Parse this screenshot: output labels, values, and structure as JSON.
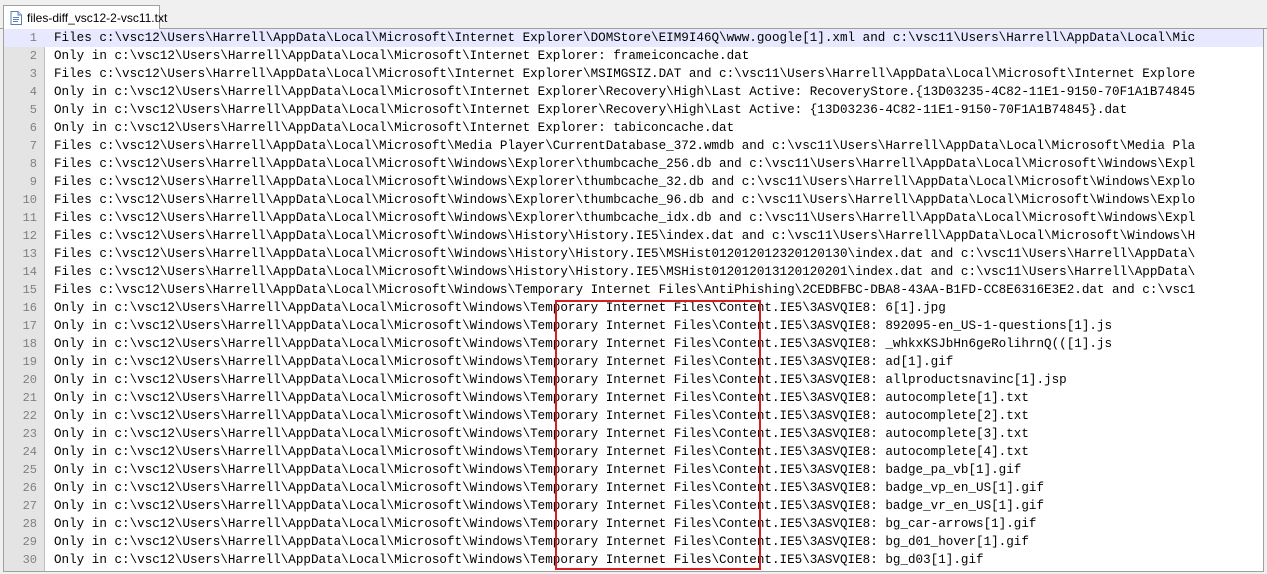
{
  "tab": {
    "title": "files-diff_vsc12-2-vsc11.txt",
    "icon": "file-icon"
  },
  "lines": [
    {
      "num": "1",
      "text": "Files c:\\vsc12\\Users\\Harrell\\AppData\\Local\\Microsoft\\Internet Explorer\\DOMStore\\EIM9I46Q\\www.google[1].xml and c:\\vsc11\\Users\\Harrell\\AppData\\Local\\Mic"
    },
    {
      "num": "2",
      "text": "Only in c:\\vsc12\\Users\\Harrell\\AppData\\Local\\Microsoft\\Internet Explorer: frameiconcache.dat"
    },
    {
      "num": "3",
      "text": "Files c:\\vsc12\\Users\\Harrell\\AppData\\Local\\Microsoft\\Internet Explorer\\MSIMGSIZ.DAT and c:\\vsc11\\Users\\Harrell\\AppData\\Local\\Microsoft\\Internet Explore"
    },
    {
      "num": "4",
      "text": "Only in c:\\vsc12\\Users\\Harrell\\AppData\\Local\\Microsoft\\Internet Explorer\\Recovery\\High\\Last Active: RecoveryStore.{13D03235-4C82-11E1-9150-70F1A1B74845"
    },
    {
      "num": "5",
      "text": "Only in c:\\vsc12\\Users\\Harrell\\AppData\\Local\\Microsoft\\Internet Explorer\\Recovery\\High\\Last Active: {13D03236-4C82-11E1-9150-70F1A1B74845}.dat"
    },
    {
      "num": "6",
      "text": "Only in c:\\vsc12\\Users\\Harrell\\AppData\\Local\\Microsoft\\Internet Explorer: tabiconcache.dat"
    },
    {
      "num": "7",
      "text": "Files c:\\vsc12\\Users\\Harrell\\AppData\\Local\\Microsoft\\Media Player\\CurrentDatabase_372.wmdb and c:\\vsc11\\Users\\Harrell\\AppData\\Local\\Microsoft\\Media Pla"
    },
    {
      "num": "8",
      "text": "Files c:\\vsc12\\Users\\Harrell\\AppData\\Local\\Microsoft\\Windows\\Explorer\\thumbcache_256.db and c:\\vsc11\\Users\\Harrell\\AppData\\Local\\Microsoft\\Windows\\Expl"
    },
    {
      "num": "9",
      "text": "Files c:\\vsc12\\Users\\Harrell\\AppData\\Local\\Microsoft\\Windows\\Explorer\\thumbcache_32.db and c:\\vsc11\\Users\\Harrell\\AppData\\Local\\Microsoft\\Windows\\Explo"
    },
    {
      "num": "10",
      "text": "Files c:\\vsc12\\Users\\Harrell\\AppData\\Local\\Microsoft\\Windows\\Explorer\\thumbcache_96.db and c:\\vsc11\\Users\\Harrell\\AppData\\Local\\Microsoft\\Windows\\Explo"
    },
    {
      "num": "11",
      "text": "Files c:\\vsc12\\Users\\Harrell\\AppData\\Local\\Microsoft\\Windows\\Explorer\\thumbcache_idx.db and c:\\vsc11\\Users\\Harrell\\AppData\\Local\\Microsoft\\Windows\\Expl"
    },
    {
      "num": "12",
      "text": "Files c:\\vsc12\\Users\\Harrell\\AppData\\Local\\Microsoft\\Windows\\History\\History.IE5\\index.dat and c:\\vsc11\\Users\\Harrell\\AppData\\Local\\Microsoft\\Windows\\H"
    },
    {
      "num": "13",
      "text": "Files c:\\vsc12\\Users\\Harrell\\AppData\\Local\\Microsoft\\Windows\\History\\History.IE5\\MSHist012012012320120130\\index.dat and c:\\vsc11\\Users\\Harrell\\AppData\\"
    },
    {
      "num": "14",
      "text": "Files c:\\vsc12\\Users\\Harrell\\AppData\\Local\\Microsoft\\Windows\\History\\History.IE5\\MSHist012012013120120201\\index.dat and c:\\vsc11\\Users\\Harrell\\AppData\\"
    },
    {
      "num": "15",
      "text": "Files c:\\vsc12\\Users\\Harrell\\AppData\\Local\\Microsoft\\Windows\\Temporary Internet Files\\AntiPhishing\\2CEDBFBC-DBA8-43AA-B1FD-CC8E6316E3E2.dat and c:\\vsc1"
    },
    {
      "num": "16",
      "text": "Only in c:\\vsc12\\Users\\Harrell\\AppData\\Local\\Microsoft\\Windows\\Temporary Internet Files\\Content.IE5\\3ASVQIE8: 6[1].jpg"
    },
    {
      "num": "17",
      "text": "Only in c:\\vsc12\\Users\\Harrell\\AppData\\Local\\Microsoft\\Windows\\Temporary Internet Files\\Content.IE5\\3ASVQIE8: 892095-en_US-1-questions[1].js"
    },
    {
      "num": "18",
      "text": "Only in c:\\vsc12\\Users\\Harrell\\AppData\\Local\\Microsoft\\Windows\\Temporary Internet Files\\Content.IE5\\3ASVQIE8: _whkxKSJbHn6geRolihrnQ(([1].js"
    },
    {
      "num": "19",
      "text": "Only in c:\\vsc12\\Users\\Harrell\\AppData\\Local\\Microsoft\\Windows\\Temporary Internet Files\\Content.IE5\\3ASVQIE8: ad[1].gif"
    },
    {
      "num": "20",
      "text": "Only in c:\\vsc12\\Users\\Harrell\\AppData\\Local\\Microsoft\\Windows\\Temporary Internet Files\\Content.IE5\\3ASVQIE8: allproductsnavinc[1].jsp"
    },
    {
      "num": "21",
      "text": "Only in c:\\vsc12\\Users\\Harrell\\AppData\\Local\\Microsoft\\Windows\\Temporary Internet Files\\Content.IE5\\3ASVQIE8: autocomplete[1].txt"
    },
    {
      "num": "22",
      "text": "Only in c:\\vsc12\\Users\\Harrell\\AppData\\Local\\Microsoft\\Windows\\Temporary Internet Files\\Content.IE5\\3ASVQIE8: autocomplete[2].txt"
    },
    {
      "num": "23",
      "text": "Only in c:\\vsc12\\Users\\Harrell\\AppData\\Local\\Microsoft\\Windows\\Temporary Internet Files\\Content.IE5\\3ASVQIE8: autocomplete[3].txt"
    },
    {
      "num": "24",
      "text": "Only in c:\\vsc12\\Users\\Harrell\\AppData\\Local\\Microsoft\\Windows\\Temporary Internet Files\\Content.IE5\\3ASVQIE8: autocomplete[4].txt"
    },
    {
      "num": "25",
      "text": "Only in c:\\vsc12\\Users\\Harrell\\AppData\\Local\\Microsoft\\Windows\\Temporary Internet Files\\Content.IE5\\3ASVQIE8: badge_pa_vb[1].gif"
    },
    {
      "num": "26",
      "text": "Only in c:\\vsc12\\Users\\Harrell\\AppData\\Local\\Microsoft\\Windows\\Temporary Internet Files\\Content.IE5\\3ASVQIE8: badge_vp_en_US[1].gif"
    },
    {
      "num": "27",
      "text": "Only in c:\\vsc12\\Users\\Harrell\\AppData\\Local\\Microsoft\\Windows\\Temporary Internet Files\\Content.IE5\\3ASVQIE8: badge_vr_en_US[1].gif"
    },
    {
      "num": "28",
      "text": "Only in c:\\vsc12\\Users\\Harrell\\AppData\\Local\\Microsoft\\Windows\\Temporary Internet Files\\Content.IE5\\3ASVQIE8: bg_car-arrows[1].gif"
    },
    {
      "num": "29",
      "text": "Only in c:\\vsc12\\Users\\Harrell\\AppData\\Local\\Microsoft\\Windows\\Temporary Internet Files\\Content.IE5\\3ASVQIE8: bg_d01_hover[1].gif"
    },
    {
      "num": "30",
      "text": "Only in c:\\vsc12\\Users\\Harrell\\AppData\\Local\\Microsoft\\Windows\\Temporary Internet Files\\Content.IE5\\3ASVQIE8: bg_d03[1].gif"
    }
  ],
  "colors": {
    "highlight_box": "#d42020",
    "current_line": "#e8e8ff",
    "gutter": "#e4e4e4",
    "line_number": "#808080"
  }
}
